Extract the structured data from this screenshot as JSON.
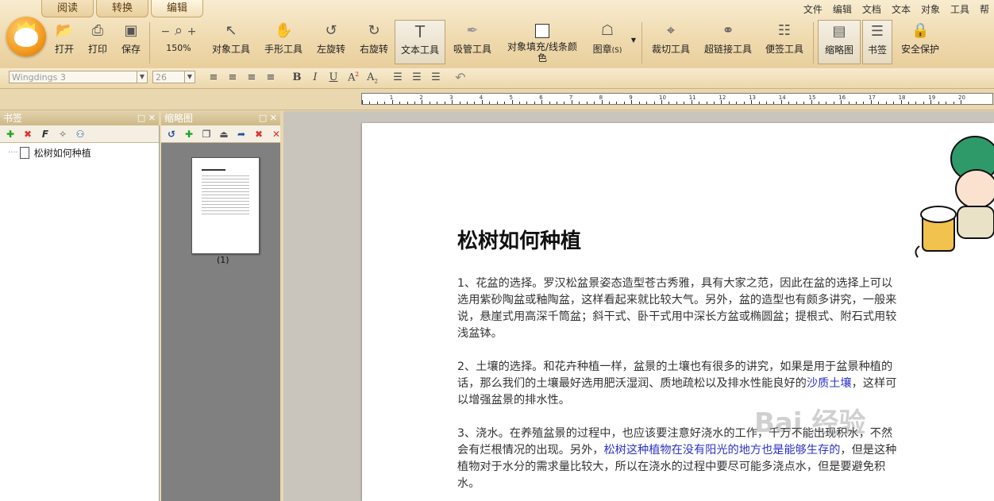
{
  "ribbon_tabs": [
    "阅读",
    "转换",
    "编辑"
  ],
  "menubar": [
    "文件",
    "编辑",
    "文档",
    "文本",
    "对象",
    "工具",
    "帮"
  ],
  "toolbar": {
    "open": "打开",
    "print": "打印",
    "save": "保存",
    "zoom": "150%",
    "zoom_minus": "−",
    "zoom_plus": "+",
    "object_tool": "对象工具",
    "hand_tool": "手形工具",
    "rotate_left": "左旋转",
    "rotate_right": "右旋转",
    "text_tool": "文本工具",
    "eyedropper_tool": "吸管工具",
    "fill_color": "对象填充/线条颜色",
    "fill_color_line1": "对象填充/线条颜",
    "fill_color_line2": "色",
    "stamp": "图章",
    "stamp_shortcut": "(S)",
    "crop_tool": "裁切工具",
    "hyperlink_tool": "超链接工具",
    "note_tool": "便签工具",
    "thumbnails": "缩略图",
    "bookmarks": "书签",
    "security": "安全保护"
  },
  "format": {
    "font": "Wingdings 3",
    "size": "26"
  },
  "ruler_labels": [
    "1",
    "2",
    "3",
    "4",
    "5",
    "6",
    "7",
    "8",
    "9",
    "10",
    "11",
    "12",
    "13",
    "14",
    "15",
    "16",
    "17",
    "18",
    "19",
    "20"
  ],
  "bookmark_panel": {
    "title": "书签",
    "items": [
      "松树如何种植"
    ]
  },
  "thumb_panel": {
    "title": "缩略图",
    "page_label": "(1)"
  },
  "document": {
    "title": "松树如何种植",
    "p1": "1、花盆的选择。罗汉松盆景姿态造型苍古秀雅，具有大家之范，因此在盆的选择上可以选用紫砂陶盆或釉陶盆，这样看起来就比较大气。另外，盆的造型也有颇多讲究，一般来说，悬崖式用高深千筒盆；斜干式、卧干式用中深长方盆或椭圆盆；提根式、附石式用较浅盆钵。",
    "p2_a": "2、土壤的选择。和花卉种植一样，盆景的土壤也有很多的讲究，如果是用于盆景种植的话，那么我们的土壤最好选用肥沃湿润、质地疏松以及排水性能良好的",
    "p2_link": "沙质土壤",
    "p2_b": "，这样可以增强盆景的排水性。",
    "p3_a": "3、浇水。在养殖盆景的过程中，也应该要注意好浇水的工作，千万不能出现积水，不然会有烂根情况的出现。另外，",
    "p3_link": "松树这种植物在没有阳光的地方也是能够生存的",
    "p3_b": "，但是这种植物对于水分的需求量比较大，所以在浇水的过程中要尽可能多浇点水，但是要避免积水。"
  },
  "watermark": "Bai 经验",
  "colors": {
    "ribbon": "#efd9ad",
    "link": "#2a34c8",
    "page": "#ffffff"
  }
}
